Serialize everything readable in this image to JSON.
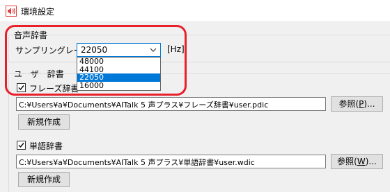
{
  "window": {
    "title": "環境設定",
    "icon": "speaker-icon"
  },
  "voice_dict": {
    "section_label": "音声辞書",
    "sampling_label": "サンプリングレート",
    "sampling_selected": "22050",
    "sampling_unit": "[Hz]",
    "options": [
      "48000",
      "44100",
      "22050",
      "16000"
    ],
    "selected_index": 2
  },
  "user_dict": {
    "section_label": "ユーザー辞書",
    "phrase": {
      "label": "フレーズ辞書",
      "checked": true,
      "path": "C:¥Users¥a¥Documents¥AITalk 5 声プラス¥フレーズ辞書¥user.pdic",
      "browse_prefix": "参照(",
      "browse_key": "P",
      "browse_suffix": ")...",
      "new_label": "新規作成"
    },
    "word": {
      "label": "単語辞書",
      "checked": true,
      "path": "C:¥Users¥a¥Documents¥AITalk 5 声プラス¥単語辞書¥user.wdic",
      "browse_prefix": "参照(",
      "browse_key": "W",
      "browse_suffix": ")...",
      "new_label": "新規作成"
    }
  },
  "colors": {
    "accent": "#0078d7",
    "highlight": "#e8202a"
  }
}
